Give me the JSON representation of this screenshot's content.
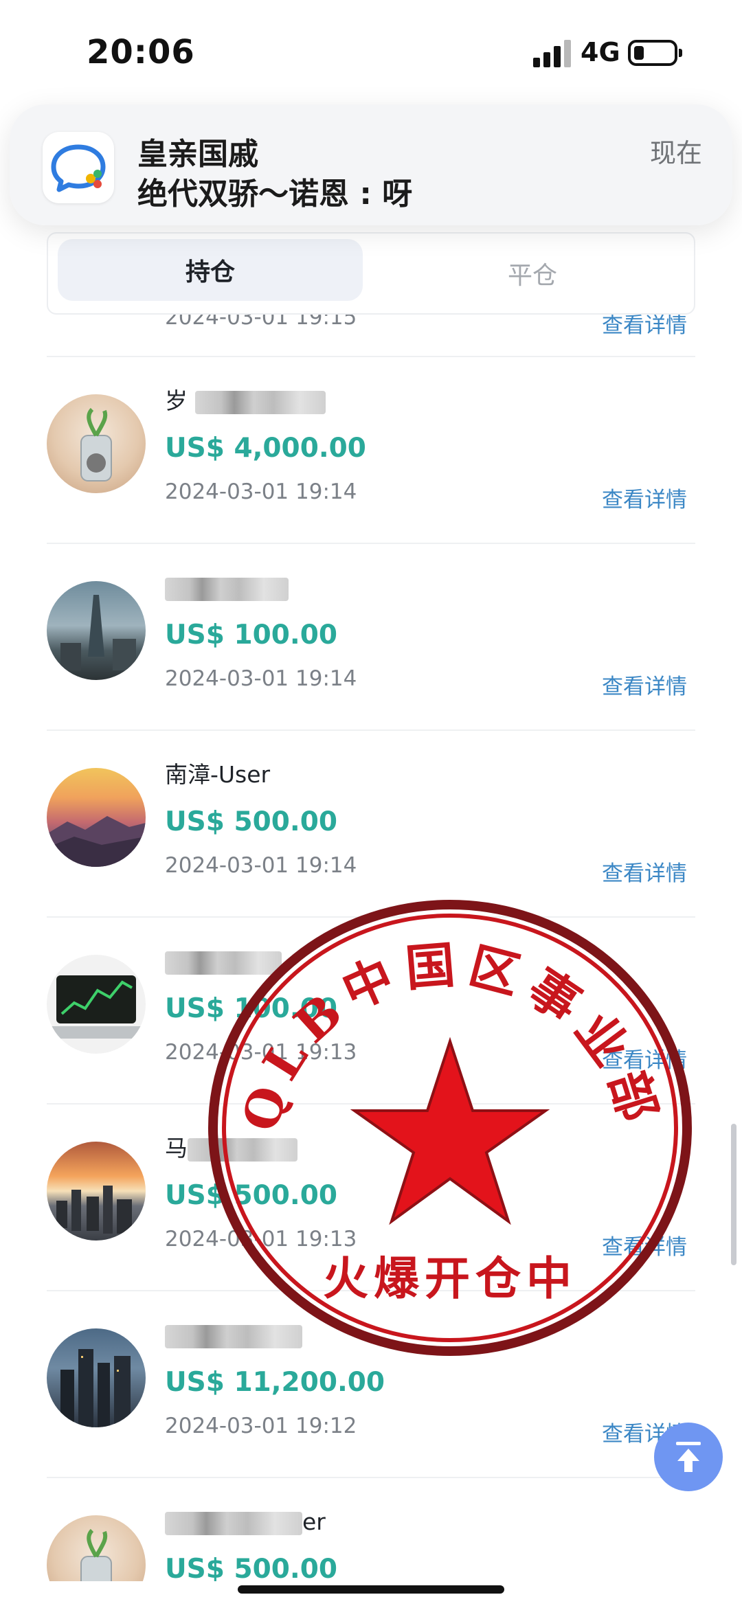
{
  "status_bar": {
    "time": "20:06",
    "network": "4G",
    "signal_bars": 4,
    "battery_level": 0.2
  },
  "notification": {
    "app_icon": "chat-bubble-icon",
    "title": "皇亲国戚",
    "body": "绝代双骄～诺恩 : 呀",
    "time": "现在"
  },
  "tabs": [
    {
      "label": "持仓",
      "active": true
    },
    {
      "label": "平仓",
      "active": false
    }
  ],
  "partial_top_row": {
    "datetime": "2024-03-01 19:15",
    "detail_label": "查看详情"
  },
  "rows": [
    {
      "name_visible": "岁",
      "amount": "US$ 4,000.00",
      "datetime": "2024-03-01 19:14",
      "detail_label": "查看详情",
      "avatar": "plant-jar"
    },
    {
      "name_visible": "",
      "amount": "US$ 100.00",
      "datetime": "2024-03-01 19:14",
      "detail_label": "查看详情",
      "avatar": "city-tower"
    },
    {
      "name_visible": "南漳-User",
      "amount": "US$ 500.00",
      "datetime": "2024-03-01 19:14",
      "detail_label": "查看详情",
      "avatar": "mountain-sunset"
    },
    {
      "name_visible": "",
      "amount": "US$ 100.00",
      "datetime": "2024-03-01 19:13",
      "detail_label": "查看详情",
      "avatar": "laptop-chart"
    },
    {
      "name_visible": "马",
      "amount": "US$ 500.00",
      "datetime": "2024-03-01 19:13",
      "detail_label": "查看详情",
      "avatar": "city-sunset"
    },
    {
      "name_visible": "",
      "amount": "US$ 11,200.00",
      "datetime": "2024-03-01 19:12",
      "detail_label": "查看详情",
      "avatar": "skyline-night"
    },
    {
      "name_visible": "er",
      "amount": "US$ 500.00",
      "datetime": "",
      "detail_label": "",
      "avatar": "plant-jar"
    }
  ],
  "seal": {
    "top_text": "QLB中国区事业部",
    "bottom_text": "火爆开仓中",
    "color": "#c8161d"
  },
  "scroll_to_top_icon": "arrow-up-to-line-icon",
  "colors": {
    "amount": "#2aa99a",
    "link": "#3b87c5",
    "fab": "#6f96f2",
    "seal": "#c8161d"
  }
}
